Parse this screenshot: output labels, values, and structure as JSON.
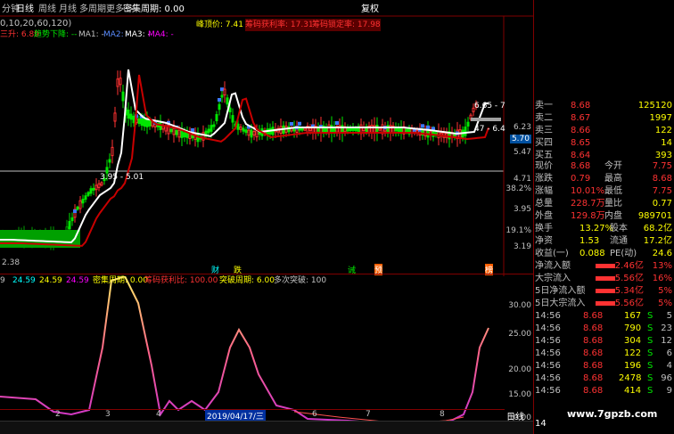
{
  "toolbar": {
    "tabs": [
      "分钟",
      "日线",
      "周线",
      "月线",
      "多周期",
      "更多 >"
    ],
    "active_tab": "日线",
    "info_center": "密集周期: 0.00",
    "restore": "复权",
    "ma_params": "0,10,20,60,120)",
    "line1_a": "三升: 6.89",
    "line1_b": "趋势下降: --",
    "line1_c": "MA1: -",
    "line1_d": "MA2: -",
    "line1_e": "MA3: -",
    "line1_f": "MA4: -",
    "peak_label": "峰顶价: 7.41",
    "chip_ratio": "筹码获利率: 17.31",
    "chip_lock": "筹码锁定率: 17.98"
  },
  "main_chart": {
    "price_labels": [
      {
        "text": "6.23"
      },
      {
        "text": "5.70"
      },
      {
        "text": "5.47"
      },
      {
        "text": "4.71"
      },
      {
        "text": "38.2%"
      },
      {
        "text": "3.95"
      },
      {
        "text": "19.1%"
      },
      {
        "text": "3.19"
      },
      {
        "text": "2.38"
      }
    ],
    "annot_high": "6.65 - 7",
    "annot_mid": "- 6.4",
    "annot_mid2": "47 - 6.4",
    "annot_low": "3.95 - 5.01",
    "bottom_low": "2.38",
    "event_tags": [
      "财",
      "跌",
      "诫",
      "预",
      "榜"
    ]
  },
  "lower_panel": {
    "label_a": "9",
    "label_b": "24.59",
    "label_c": "24.59",
    "label_d": "24.59",
    "label_e": "密集周期: 0.00",
    "label_f": "筹码获利比: 100.00",
    "label_g": "突破周期: 6.00",
    "label_h": "多次突破: 100",
    "y_ticks": [
      "30.00",
      "25.00",
      "20.00",
      "15.00",
      "10.00"
    ],
    "x_ticks": [
      "2",
      "3",
      "4",
      "5",
      "6",
      "7",
      "8"
    ],
    "date_label": "2019/04/17/三",
    "period_tab": "日线"
  },
  "quote": {
    "sell": [
      {
        "name": "卖一",
        "price": "8.68",
        "vol": "125120"
      },
      {
        "name": "卖二",
        "price": "8.67",
        "vol": "1997"
      },
      {
        "name": "卖三",
        "price": "8.66",
        "vol": "122"
      },
      {
        "name": "买四",
        "price": "8.65",
        "vol": "14"
      },
      {
        "name": "买五",
        "price": "8.64",
        "vol": "393"
      }
    ],
    "stats": [
      {
        "l": "现价",
        "v": "8.68",
        "l2": "今开",
        "v2": "7.75"
      },
      {
        "l": "涨跌",
        "v": "0.79",
        "l2": "最高",
        "v2": "8.68"
      },
      {
        "l": "涨幅",
        "v": "10.01%",
        "l2": "最低",
        "v2": "7.75"
      },
      {
        "l": "总量",
        "v": "228.7万",
        "l2": "量比",
        "v2": "0.77"
      },
      {
        "l": "外盘",
        "v": "129.8万",
        "l2": "内盘",
        "v2": "989701"
      }
    ],
    "stats2": [
      {
        "l": "换手",
        "v": "13.27%",
        "l2": "股本",
        "v2": "68.2亿"
      },
      {
        "l": "净资",
        "v": "1.53",
        "l2": "流通",
        "v2": "17.2亿"
      },
      {
        "l": "收益(一)",
        "v": "0.088",
        "l2": "PE(动)",
        "v2": "24.6"
      }
    ],
    "flows": [
      {
        "l": "净流入额",
        "v": "2.46亿",
        "p": "13%"
      },
      {
        "l": "大宗流入",
        "v": "5.56亿",
        "p": "16%"
      },
      {
        "l": "5日净流入额",
        "v": "5.34亿",
        "p": "5%"
      },
      {
        "l": "5日大宗流入",
        "v": "5.56亿",
        "p": "5%"
      }
    ],
    "trades": [
      {
        "t": "14:56",
        "p": "8.68",
        "v": "167",
        "s": "S",
        "n": "5"
      },
      {
        "t": "14:56",
        "p": "8.68",
        "v": "790",
        "s": "S",
        "n": "23"
      },
      {
        "t": "14:56",
        "p": "8.68",
        "v": "304",
        "s": "S",
        "n": "12"
      },
      {
        "t": "14:56",
        "p": "8.68",
        "v": "122",
        "s": "S",
        "n": "6"
      },
      {
        "t": "14:56",
        "p": "8.68",
        "v": "196",
        "s": "S",
        "n": "4"
      },
      {
        "t": "14:56",
        "p": "8.68",
        "v": "2478",
        "s": "S",
        "n": "96"
      },
      {
        "t": "14:56",
        "p": "8.68",
        "v": "414",
        "s": "S",
        "n": "9"
      }
    ],
    "bottom": "14",
    "watermark": "www.7gpzb.com"
  },
  "colors": {
    "up": "#ff3232",
    "down": "#00e600",
    "yellow": "#ffff00",
    "cyan": "#00ffff",
    "magenta": "#ff00ff",
    "blue": "#5a8cff"
  }
}
